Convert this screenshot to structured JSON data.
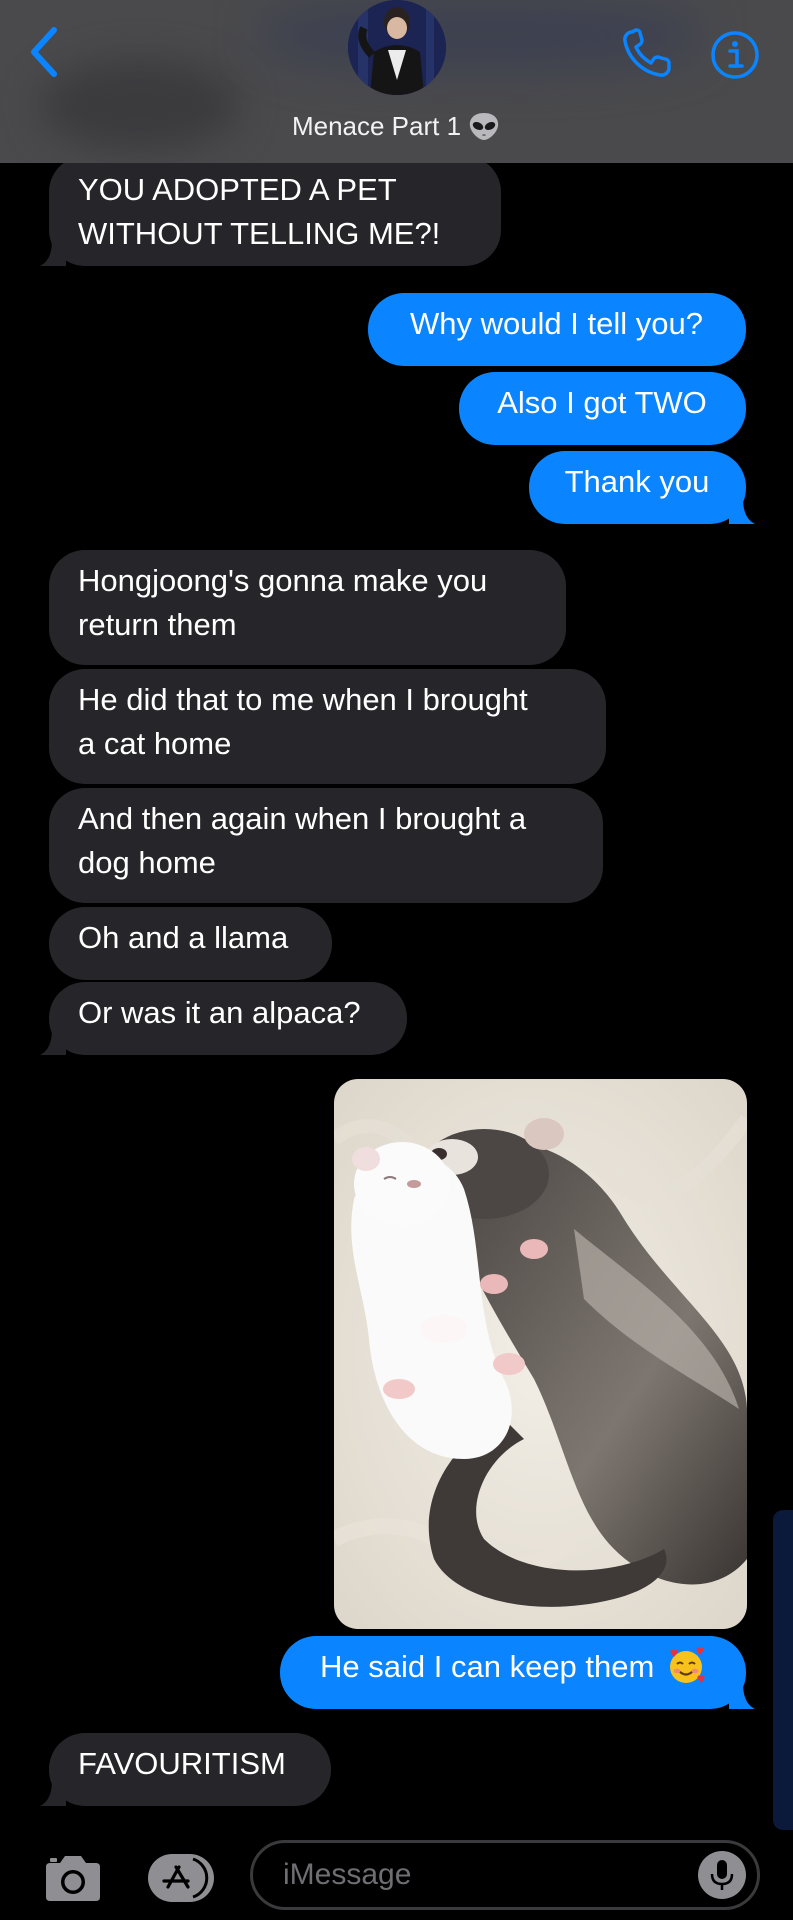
{
  "header": {
    "contact_name": "Menace Part 1",
    "contact_emoji": "alien-emoji",
    "back_icon": "chevron-left-icon",
    "call_icon": "phone-icon",
    "info_icon": "info-icon",
    "accent_color": "#0a84ff"
  },
  "messages": [
    {
      "direction": "received",
      "text_line1": "YOU ADOPTED A PET",
      "text_line2": "WITHOUT TELLING ME?!"
    },
    {
      "direction": "sent",
      "text": "Why would I tell you?"
    },
    {
      "direction": "sent",
      "text": "Also I got TWO"
    },
    {
      "direction": "sent",
      "text": "Thank you"
    },
    {
      "direction": "received",
      "text_line1": "Hongjoong's gonna make you",
      "text_line2": "return them"
    },
    {
      "direction": "received",
      "text_line1": "He did that to me when I brought",
      "text_line2": "a cat home"
    },
    {
      "direction": "received",
      "text_line1": "And then again when I brought a",
      "text_line2": "dog home"
    },
    {
      "direction": "received",
      "text": "Oh and a llama"
    },
    {
      "direction": "received",
      "text": "Or was it an alpaca?"
    },
    {
      "direction": "sent",
      "type": "photo",
      "photo_subject": "two ferrets cuddling on white fur"
    },
    {
      "direction": "sent",
      "text": "He said I can keep them",
      "emoji": "smiling-face-with-hearts"
    },
    {
      "direction": "received",
      "text": "FAVOURITISM"
    }
  ],
  "input_bar": {
    "placeholder": "iMessage",
    "camera_icon": "camera-icon",
    "apps_icon": "app-store-icon",
    "mic_icon": "microphone-icon"
  },
  "colors": {
    "sent_bubble": "#0a84ff",
    "received_bubble": "#262529",
    "background": "#000000",
    "header": "#4a4a4d"
  }
}
